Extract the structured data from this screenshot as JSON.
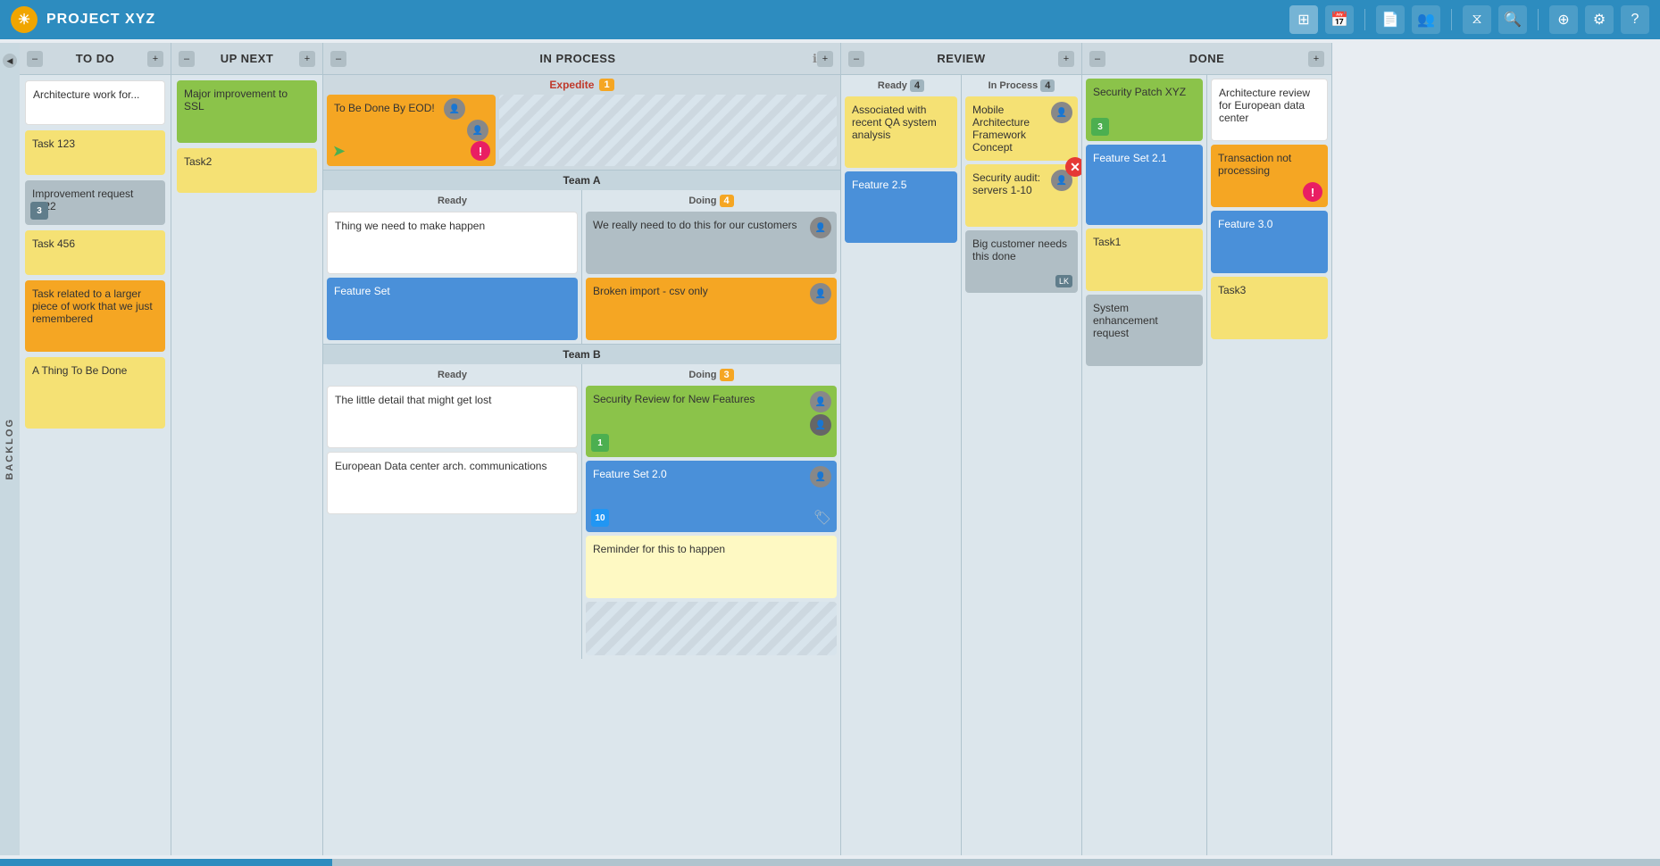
{
  "header": {
    "logo": "☀",
    "title": "PROJECT XYZ",
    "icons": [
      "grid-icon",
      "calendar-icon",
      "file-icon",
      "user-icon",
      "filter-icon",
      "search-icon",
      "help-icon",
      "settings-icon",
      "question-icon"
    ]
  },
  "backlog": {
    "label": "BACKLOG"
  },
  "columns": {
    "todo": {
      "title": "TO DO",
      "cards": [
        {
          "text": "Architecture work for...",
          "color": "white"
        },
        {
          "text": "Task 123",
          "color": "yellow"
        },
        {
          "text": "Improvement request #522",
          "color": "gray",
          "badge": "3",
          "badge_color": "gray"
        },
        {
          "text": "Task 456",
          "color": "yellow"
        },
        {
          "text": "Task related to a larger piece of work that we just remembered",
          "color": "orange"
        },
        {
          "text": "A Thing To Be Done",
          "color": "yellow"
        }
      ]
    },
    "upnext": {
      "title": "UP NEXT",
      "cards": [
        {
          "text": "Major improvement to SSL",
          "color": "green"
        },
        {
          "text": "Task2",
          "color": "yellow"
        }
      ]
    },
    "inprocess": {
      "title": "IN PROCESS",
      "expedite": {
        "label": "Expedite",
        "count": "1",
        "card": {
          "text": "To Be Done By EOD!",
          "color": "orange",
          "has_arrow": true,
          "has_exclaim": true
        }
      },
      "teams": [
        {
          "name": "Team A",
          "ready_cards": [
            {
              "text": "Thing we need to make happen",
              "color": "white"
            },
            {
              "text": "Feature Set",
              "color": "blue"
            }
          ],
          "doing_count": "4",
          "doing_cards": [
            {
              "text": "We really need to do this for our customers",
              "color": "gray",
              "has_avatar": true
            },
            {
              "text": "Broken import - csv only",
              "color": "orange",
              "has_avatar": true
            }
          ]
        },
        {
          "name": "Team B",
          "ready_cards": [
            {
              "text": "The little detail that might get lost",
              "color": "white"
            },
            {
              "text": "European Data center arch. communications",
              "color": "white"
            }
          ],
          "doing_count": "3",
          "doing_cards": [
            {
              "text": "Security Review for New Features",
              "color": "green",
              "has_avatar": true,
              "badge": "1",
              "badge_color": "green"
            },
            {
              "text": "Feature Set 2.0",
              "color": "blue",
              "has_avatar": true,
              "badge": "10",
              "badge_color": "blue",
              "has_tag": true
            },
            {
              "text": "Reminder for this to happen",
              "color": "light-yellow"
            }
          ]
        }
      ]
    },
    "review": {
      "title": "REVIEW",
      "ready": {
        "label": "Ready",
        "count": "4",
        "cards": [
          {
            "text": "Associated with recent QA system analysis",
            "color": "yellow"
          },
          {
            "text": "Feature 2.5",
            "color": "blue"
          }
        ]
      },
      "inprocess": {
        "label": "In Process",
        "count": "4",
        "cards": [
          {
            "text": "Mobile Architecture Framework Concept",
            "color": "yellow",
            "has_avatar": true
          },
          {
            "text": "Security audit: servers 1-10",
            "color": "yellow",
            "has_avatar": true,
            "has_close": true
          },
          {
            "text": "Big customer needs this done",
            "color": "gray",
            "has_lk": true
          }
        ]
      }
    },
    "done": {
      "title": "DONE",
      "cards": [
        {
          "text": "Security Patch XYZ",
          "color": "green",
          "badge": "3",
          "badge_color": "green"
        },
        {
          "text": "Architecture review for European data center",
          "color": "white"
        },
        {
          "text": "Feature Set 2.1",
          "color": "blue"
        },
        {
          "text": "Transaction not processing",
          "color": "orange",
          "has_exclaim": true
        },
        {
          "text": "Task1",
          "color": "yellow"
        },
        {
          "text": "Feature 3.0",
          "color": "blue"
        },
        {
          "text": "System enhancement request",
          "color": "gray"
        },
        {
          "text": "Task3",
          "color": "yellow"
        }
      ]
    }
  }
}
